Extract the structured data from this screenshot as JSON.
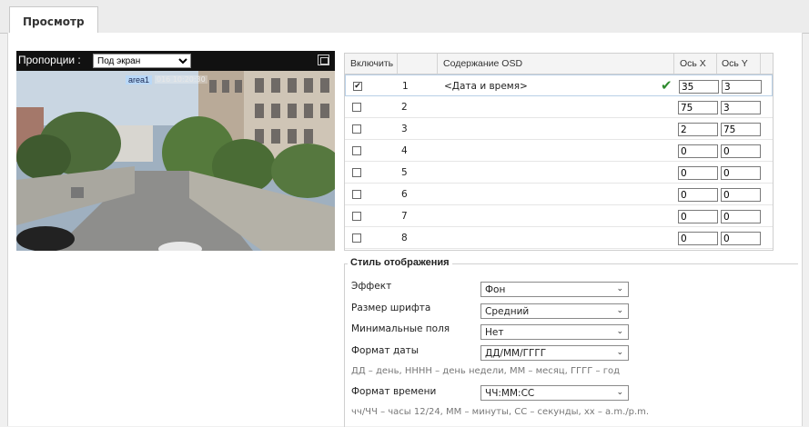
{
  "tab": {
    "label": "Просмотр"
  },
  "video": {
    "proportion_label": "Пропорции :",
    "proportion_value": "Под экран",
    "area_label": "area1",
    "date_overlay": "016 10:20:30"
  },
  "table": {
    "headers": {
      "enable": "Включить",
      "content": "Содержание OSD",
      "x": "Ось X",
      "y": "Ось Y"
    },
    "rows": [
      {
        "num": "1",
        "checked": true,
        "content": "<Дата и время>",
        "x": "35",
        "y": "3"
      },
      {
        "num": "2",
        "checked": false,
        "content": "",
        "x": "75",
        "y": "3"
      },
      {
        "num": "3",
        "checked": false,
        "content": "",
        "x": "2",
        "y": "75"
      },
      {
        "num": "4",
        "checked": false,
        "content": "",
        "x": "0",
        "y": "0"
      },
      {
        "num": "5",
        "checked": false,
        "content": "",
        "x": "0",
        "y": "0"
      },
      {
        "num": "6",
        "checked": false,
        "content": "",
        "x": "0",
        "y": "0"
      },
      {
        "num": "7",
        "checked": false,
        "content": "",
        "x": "0",
        "y": "0"
      },
      {
        "num": "8",
        "checked": false,
        "content": "",
        "x": "0",
        "y": "0"
      }
    ]
  },
  "style": {
    "legend": "Стиль отображения",
    "effect_label": "Эффект",
    "effect_value": "Фон",
    "font_size_label": "Размер шрифта",
    "font_size_value": "Средний",
    "margins_label": "Минимальные поля",
    "margins_value": "Нет",
    "date_format_label": "Формат даты",
    "date_format_value": "ДД/ММ/ГГГГ",
    "date_hint": "ДД – день, НННН – день недели, ММ – месяц, ГГГГ – год",
    "time_format_label": "Формат времени",
    "time_format_value": "ЧЧ:ММ:СС",
    "time_hint": "чч/ЧЧ – часы 12/24, ММ – минуты, СС – секунды, хх – a.m./p.m."
  },
  "colors": {
    "check": "#2e8b2e",
    "selection": "#b8cfe6",
    "area_tag": "#b9d8f7"
  }
}
